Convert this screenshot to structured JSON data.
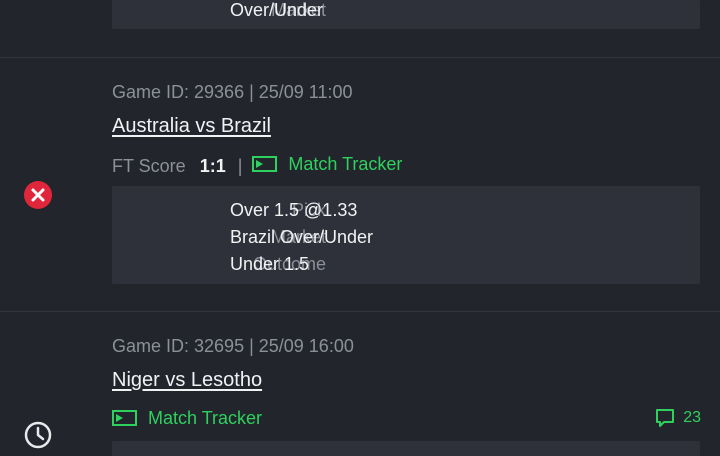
{
  "bets": [
    {
      "details": {
        "market_label": "Market",
        "market_value": "Over/Under"
      }
    },
    {
      "status": "lost",
      "status_icon": "cross-circle-icon",
      "status_color": "#e0263a",
      "game_meta": "Game ID: 29366 | 25/09 11:00",
      "match": "Australia vs Brazil",
      "score_label": "FT Score",
      "score_value": "1:1",
      "separator": "|",
      "tracker_label": "Match Tracker",
      "details": {
        "pick_label": "Pick",
        "pick_value": "Over 1.5 @1.33",
        "market_label": "Market",
        "market_value": "Brazil Over/Under",
        "outcome_label": "Outcome",
        "outcome_value": "Under 1.5"
      }
    },
    {
      "status": "pending",
      "status_icon": "clock-icon",
      "game_meta": "Game ID: 32695 | 25/09 16:00",
      "match": "Niger vs Lesotho",
      "tracker_label": "Match Tracker",
      "comments_icon": "comment-icon",
      "comments_count": "23"
    }
  ],
  "colors": {
    "background": "#22252c",
    "card": "#2e3139",
    "accent_green": "#2ed15e",
    "muted_text": "#8c9098"
  }
}
